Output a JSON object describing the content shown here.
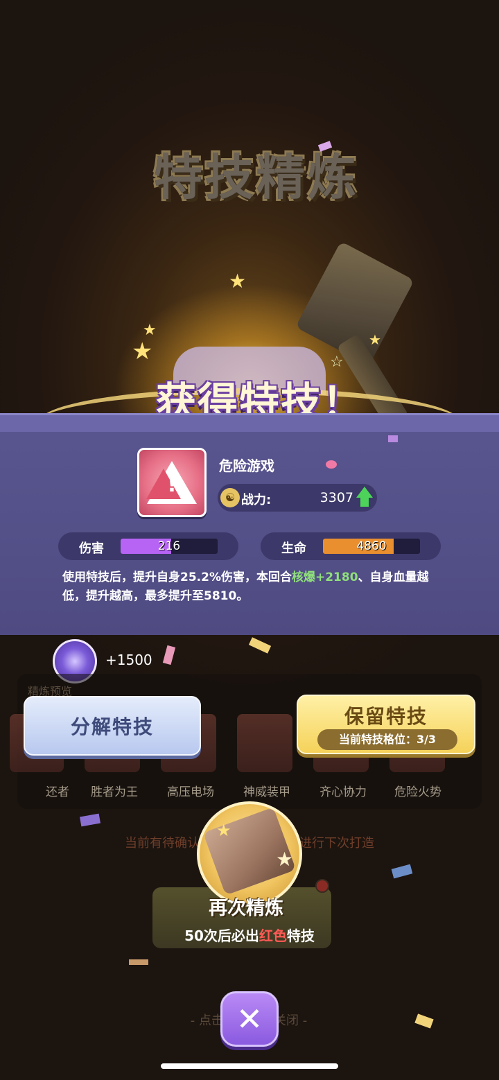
{
  "header": {
    "title": "特技精炼"
  },
  "result": {
    "headline": "获得特技！"
  },
  "skill": {
    "name": "危险游戏",
    "power_label": "战力:",
    "power_value": "3307",
    "damage_label": "伤害",
    "damage_value": "216",
    "damage_fill_fraction": 0.52,
    "hp_label": "生命",
    "hp_value": "4860",
    "hp_fill_fraction": 0.73,
    "description_prefix": "使用特技后，提升自身25.2%伤害，本回合",
    "description_highlight": "核爆+2180",
    "description_suffix": "、自身血量越低，提升越高，最多提升至5810。",
    "icon": "warning-triangle-icon"
  },
  "reward": {
    "amount": "+1500",
    "icon": "gem-icon"
  },
  "preview": {
    "title": "精炼预览",
    "items": [
      "还者",
      "胜者为王",
      "高压电场",
      "神威装甲",
      "齐心协力",
      "危险火势"
    ]
  },
  "buttons": {
    "decompose": "分解特技",
    "keep": "保留特技",
    "keep_sub": "当前特技格位：3/3"
  },
  "notice": {
    "pending": "当前有待确认的特技，确认后可进行下次打造"
  },
  "refine": {
    "title": "再次精炼",
    "sub_prefix": "50次后必出",
    "sub_highlight": "红色",
    "sub_suffix": "特技"
  },
  "footer": {
    "close_hint": "- 点击任意区域关闭 -",
    "close_icon": "close-icon"
  },
  "colors": {
    "panel": "#55518a",
    "damage_bar": "#b764f5",
    "hp_bar": "#e98f30",
    "highlight_green": "#8fe07a",
    "highlight_red": "#ff5a55",
    "close_button": "#a070ea"
  }
}
